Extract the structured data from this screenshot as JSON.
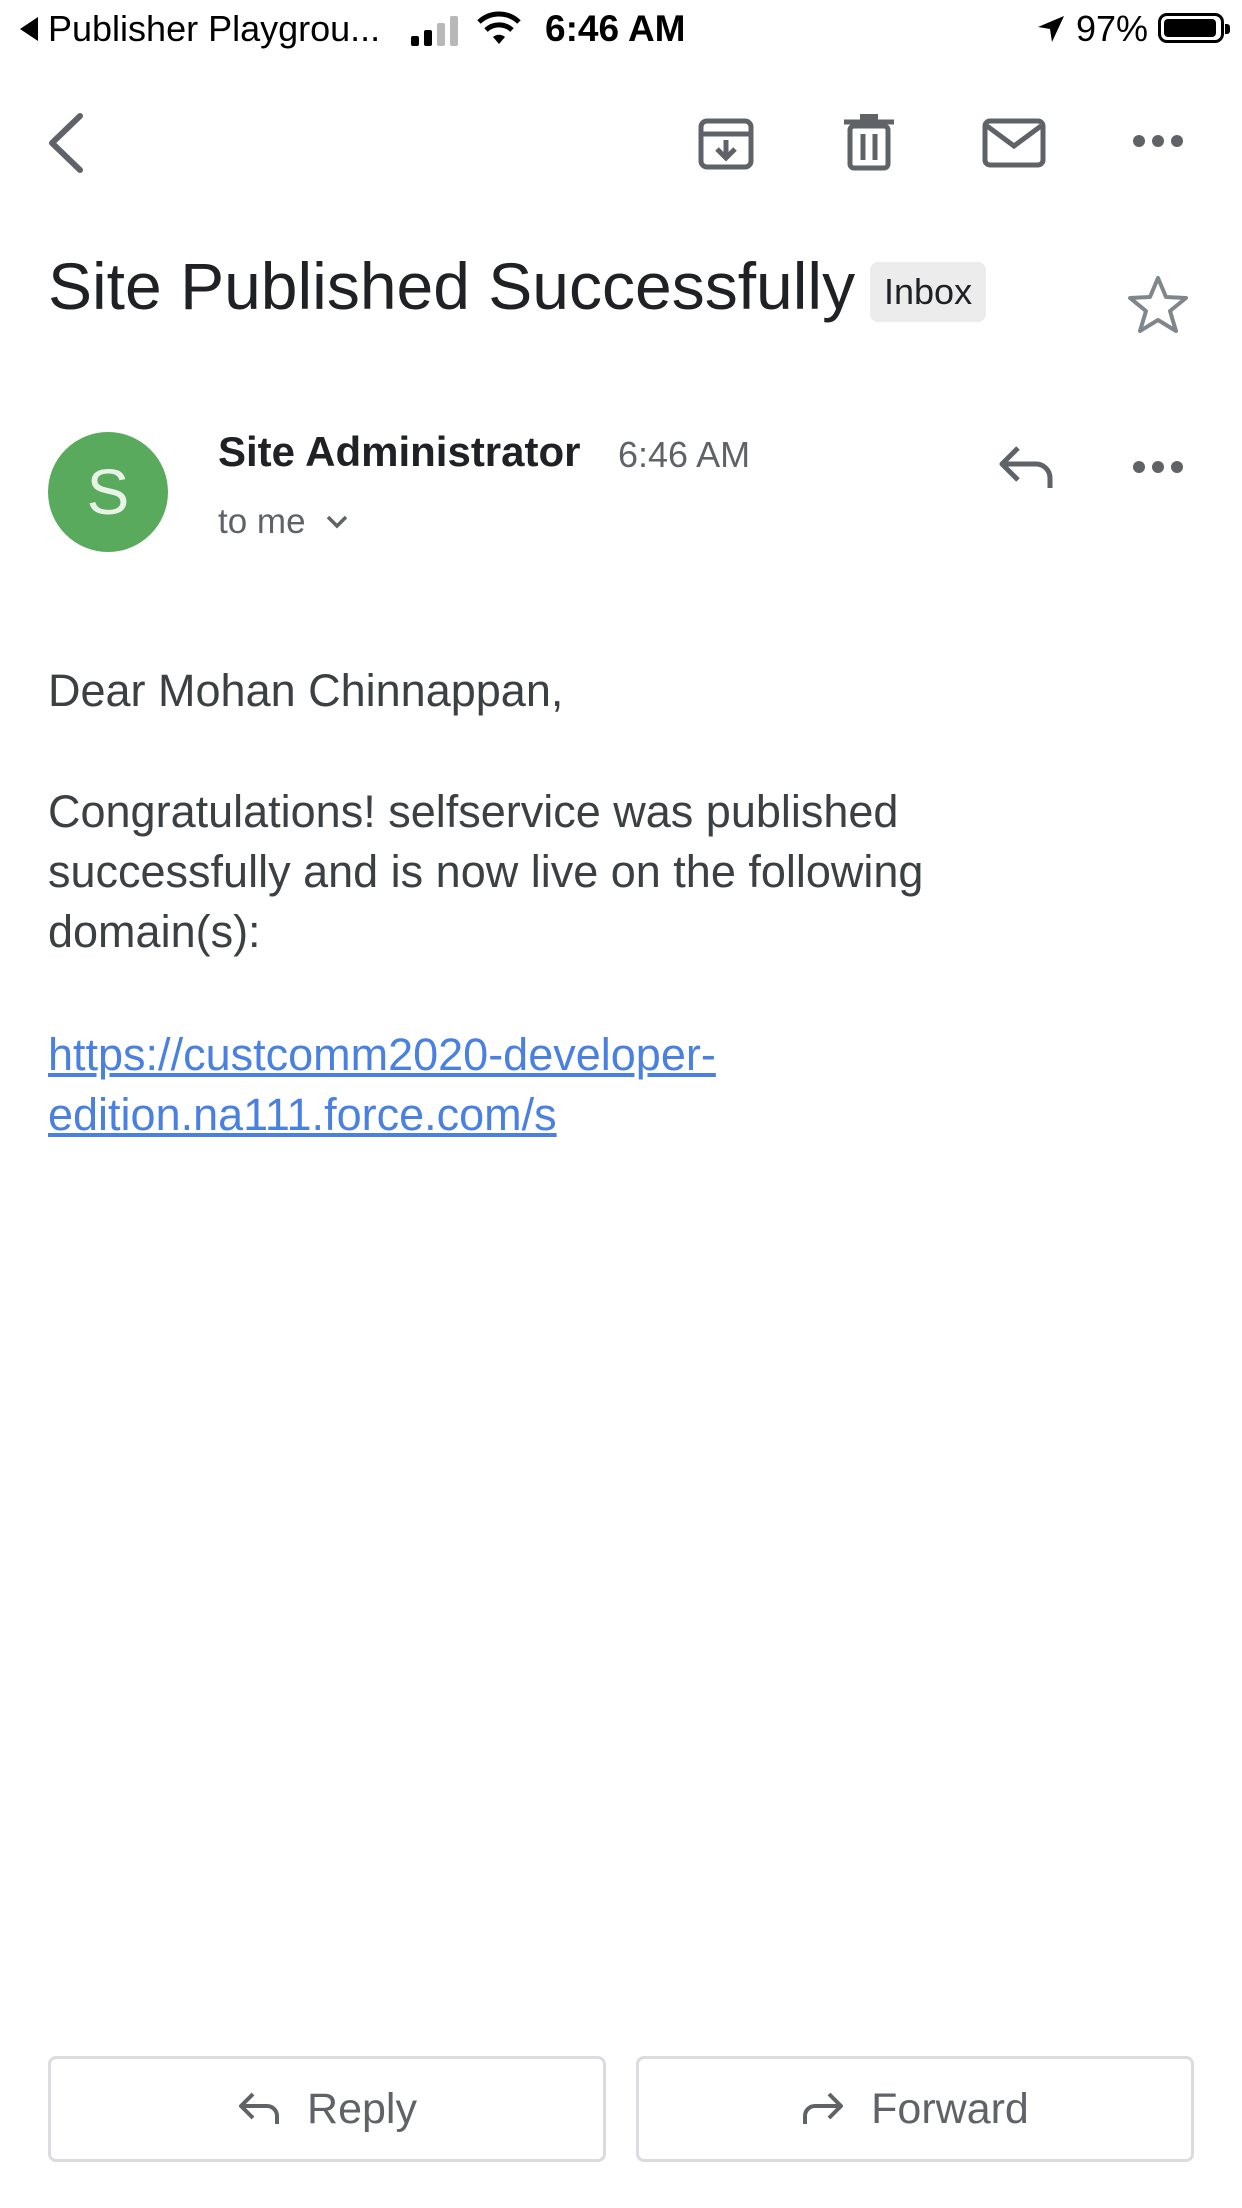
{
  "status_bar": {
    "back_app": "Publisher Playgrou...",
    "time": "6:46 AM",
    "battery_percent": "97%"
  },
  "toolbar": {
    "icons": [
      "back-arrow-icon",
      "archive-icon",
      "delete-icon",
      "mark-unread-icon",
      "more-icon"
    ]
  },
  "email": {
    "subject": "Site Published Successfully",
    "label": "Inbox",
    "sender_initial": "S",
    "sender": "Site Administrator",
    "time": "6:46 AM",
    "recipient": "to me",
    "greeting": "Dear Mohan Chinnappan,",
    "body_lines": [
      "Congratulations! selfservice was published",
      "successfully and is now live on the following",
      "domain(s):"
    ],
    "link_lines": [
      "https://custcomm2020-developer-",
      "edition.na111.force.com/s"
    ]
  },
  "actions": {
    "reply": "Reply",
    "forward": "Forward"
  },
  "colors": {
    "avatar": "#5aaa5e",
    "link": "#4a80e0",
    "badge_bg": "#ececec"
  }
}
